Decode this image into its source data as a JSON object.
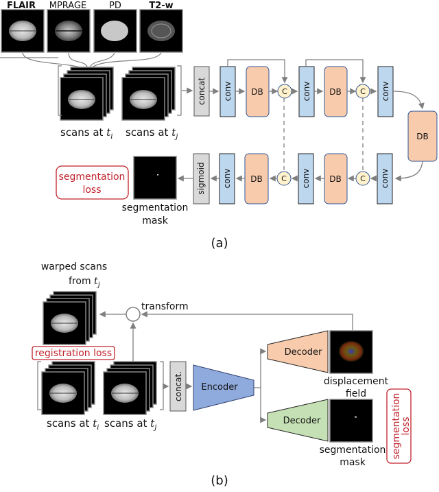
{
  "panel_a": {
    "caption": "(a)",
    "modalities": [
      "FLAIR",
      "MPRAGE",
      "PD",
      "T2-w"
    ],
    "scans_ti": {
      "text": "scans at ",
      "var": "t",
      "sub": "i"
    },
    "scans_tj": {
      "text": "scans at ",
      "var": "t",
      "sub": "j"
    },
    "concat": "concat",
    "conv": "conv",
    "db": "DB",
    "c": "C",
    "sigmoid": "sigmoid",
    "output": {
      "line1": "segmentation",
      "line2": "mask"
    },
    "loss": {
      "line1": "segmentation",
      "line2": "loss"
    }
  },
  "panel_b": {
    "caption": "(b)",
    "warped": {
      "line1": "warped scans",
      "line2": "from ",
      "var": "t",
      "sub": "j"
    },
    "transform": "transform",
    "registration_loss": "registration loss",
    "scans_ti": {
      "text": "scans at ",
      "var": "t",
      "sub": "i"
    },
    "scans_tj": {
      "text": "scans at ",
      "var": "t",
      "sub": "j"
    },
    "concat": "concat.",
    "encoder": "Encoder",
    "decoder_top": "Decoder",
    "decoder_bottom": "Decoder",
    "displacement": {
      "line1": "displacement",
      "line2": "field"
    },
    "segmentation": {
      "line1": "segmentation",
      "line2": "mask"
    },
    "loss": {
      "line1": "segmentation",
      "line2": "loss"
    }
  },
  "colors": {
    "conv_fill": "#bdd7ee",
    "db_fill": "#f8cbad",
    "c_fill": "#fff2cc",
    "concat_fill": "#d9d9d9",
    "encoder_fill": "#8faadc",
    "decoder_seg_fill": "#c5e0b4",
    "loss_red": "#c0202a",
    "arrow_gray": "#7f7f7f"
  }
}
